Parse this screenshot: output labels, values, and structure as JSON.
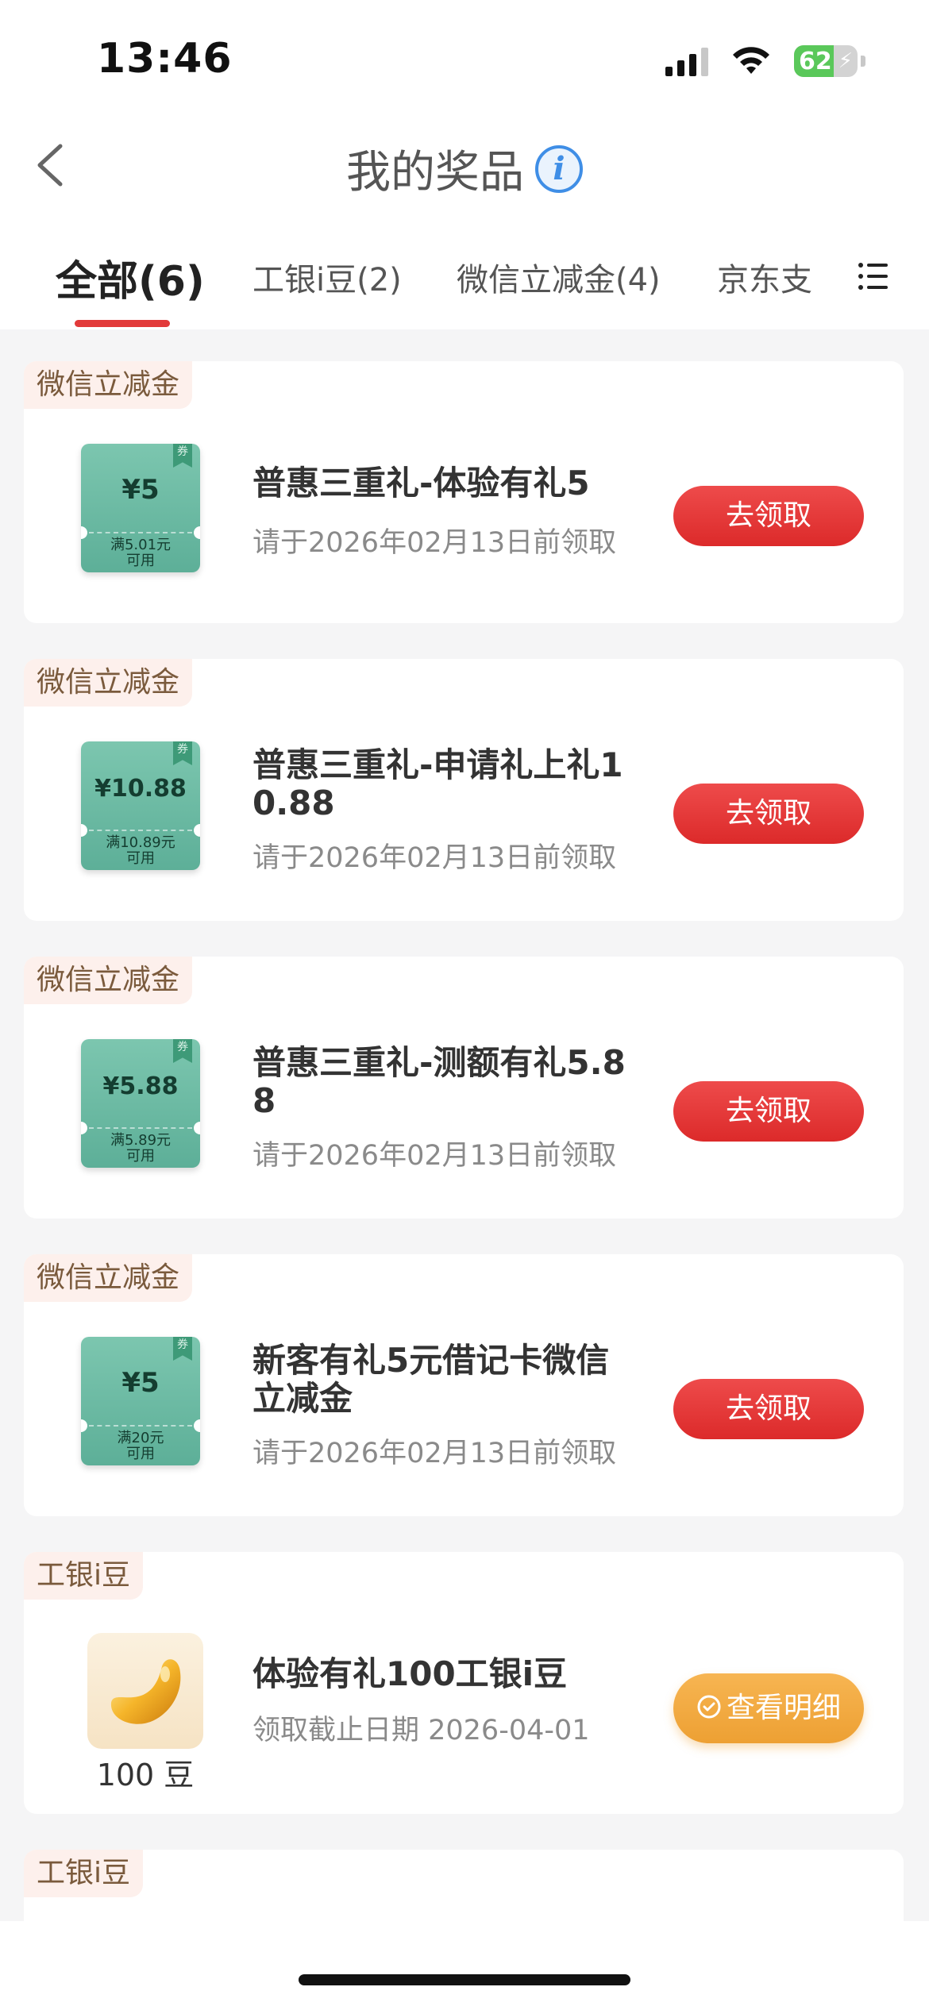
{
  "status_bar": {
    "time": "13:46",
    "battery": "62"
  },
  "header": {
    "title": "我的奖品"
  },
  "tabs": [
    {
      "label": "全部(6)",
      "active": true
    },
    {
      "label": "工银i豆(2)",
      "active": false
    },
    {
      "label": "微信立减金(4)",
      "active": false
    },
    {
      "label": "京东支",
      "active": false
    }
  ],
  "items": [
    {
      "tag": "微信立减金",
      "coupon_amount": "¥5",
      "coupon_cond_line1": "满5.01元",
      "coupon_cond_line2": "可用",
      "coupon_badge": "券",
      "title": "普惠三重礼-体验有礼5",
      "subtitle": "请于2026年02月13日前领取",
      "action": "去领取"
    },
    {
      "tag": "微信立减金",
      "coupon_amount": "¥10.88",
      "coupon_cond_line1": "满10.89元",
      "coupon_cond_line2": "可用",
      "coupon_badge": "券",
      "title_line1": "普惠三重礼-申请礼上礼1",
      "title_line2": "0.88",
      "subtitle": "请于2026年02月13日前领取",
      "action": "去领取"
    },
    {
      "tag": "微信立减金",
      "coupon_amount": "¥5.88",
      "coupon_cond_line1": "满5.89元",
      "coupon_cond_line2": "可用",
      "coupon_badge": "券",
      "title_line1": "普惠三重礼-测额有礼5.8",
      "title_line2": "8",
      "subtitle": "请于2026年02月13日前领取",
      "action": "去领取"
    },
    {
      "tag": "微信立减金",
      "coupon_amount": "¥5",
      "coupon_cond_line1": "满20元",
      "coupon_cond_line2": "可用",
      "coupon_badge": "券",
      "title_line1": "新客有礼5元借记卡微信",
      "title_line2": "立减金",
      "subtitle": "请于2026年02月13日前领取",
      "action": "去领取"
    },
    {
      "tag": "工银i豆",
      "bean_label": "100 豆",
      "title": "体验有礼100工银i豆",
      "subtitle": "领取截止日期 2026-04-01",
      "action": "查看明细"
    },
    {
      "tag": "工银i豆"
    }
  ]
}
